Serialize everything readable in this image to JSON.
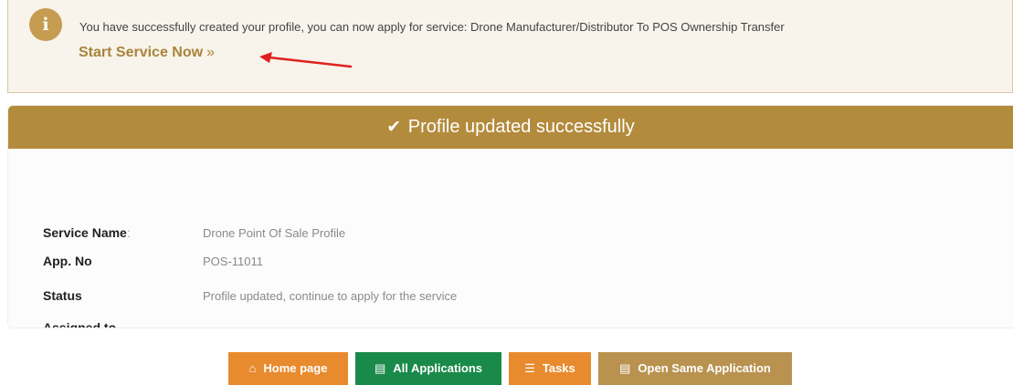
{
  "notice": {
    "icon": "info-icon",
    "message": "You have successfully created your profile, you can now apply for service: Drone Manufacturer/Distributor To POS Ownership Transfer",
    "link_label": "Start Service Now",
    "link_chevron": "»"
  },
  "card": {
    "header": "Profile updated successfully",
    "header_icon": "✔",
    "rows": [
      {
        "label": "Service Name",
        "suffix": ":",
        "value": "Drone Point Of Sale Profile"
      },
      {
        "label": "App. No",
        "suffix": "",
        "value": "POS-11011"
      },
      {
        "label": "Status",
        "suffix": "",
        "value": "Profile updated, continue to apply for the service"
      },
      {
        "label": "Assigned to",
        "suffix": "",
        "value": "-"
      }
    ]
  },
  "buttons": {
    "home": {
      "label": "Home page",
      "icon": "home-icon"
    },
    "all_applications": {
      "label": "All Applications",
      "icon": "film-icon"
    },
    "tasks": {
      "label": "Tasks",
      "icon": "list-icon"
    },
    "open_same": {
      "label": "Open Same Application",
      "icon": "film-icon"
    }
  },
  "colors": {
    "accent": "#b38b3c",
    "notice_bg": "#f8f3eb",
    "orange": "#e88b2e",
    "green": "#1a8a4a",
    "tan": "#b99250",
    "arrow": "#e02020"
  }
}
